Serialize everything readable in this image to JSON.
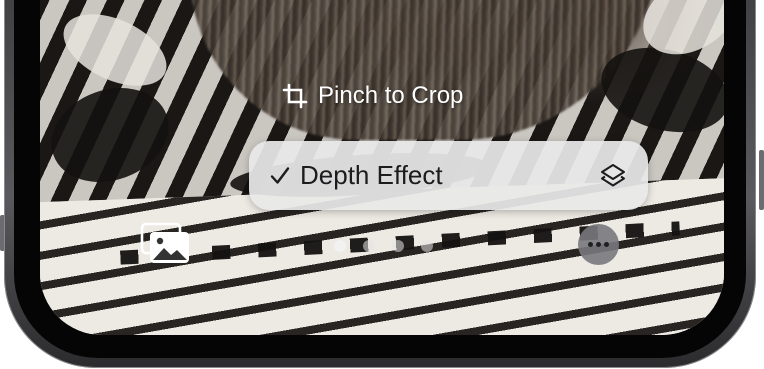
{
  "wallpaper_editor": {
    "crop_hint_label": "Pinch to Crop",
    "depth_effect": {
      "label": "Depth Effect",
      "checked": true,
      "check_glyph": "✓"
    },
    "page_indicator": {
      "total": 4,
      "active_index": 0
    }
  },
  "icons": {
    "crop": "crop-icon",
    "checkmark": "checkmark-icon",
    "layers": "layers-icon",
    "photos": "photos-icon",
    "more": "more-icon"
  },
  "colors": {
    "pill_background": "#e8e8e8",
    "pill_text": "#1c1c1e",
    "hint_text": "#ffffff",
    "more_button": "#78787c",
    "bezel": "#050505",
    "frame": "#4a4a4e"
  }
}
